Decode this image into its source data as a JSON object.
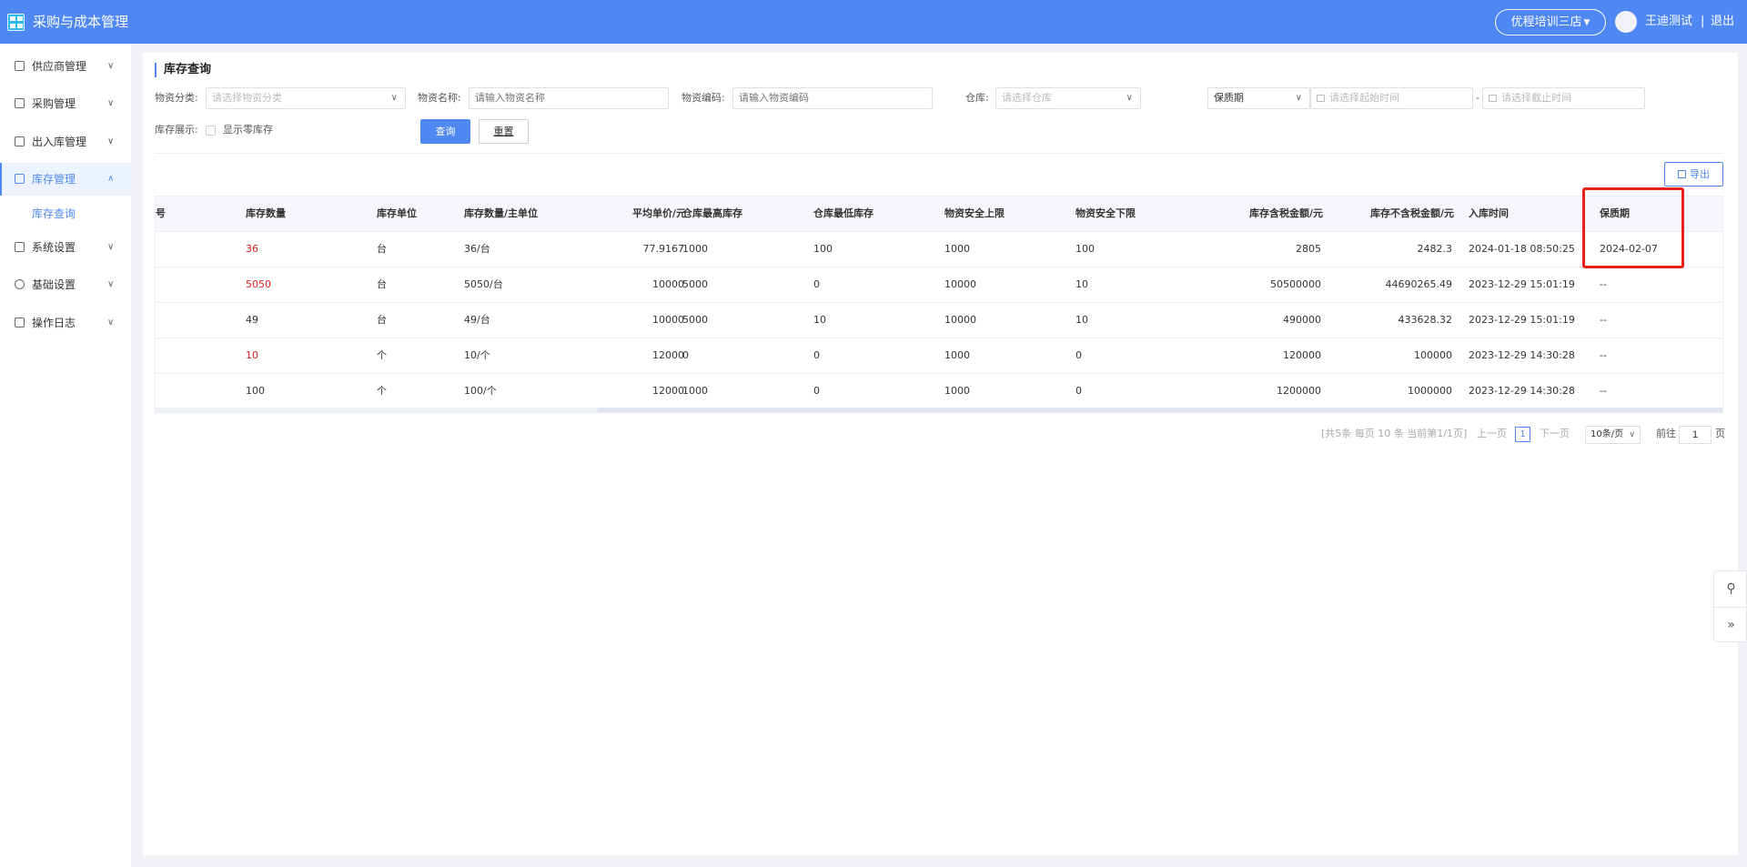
{
  "header": {
    "app_title": "采购与成本管理",
    "store": "优程培训三店",
    "user_name": "王迪测试",
    "separator": "|",
    "logout": "退出"
  },
  "sidebar": {
    "items": [
      {
        "label": "供应商管理",
        "icon": "supplier-icon"
      },
      {
        "label": "采购管理",
        "icon": "cart-icon"
      },
      {
        "label": "出入库管理",
        "icon": "inout-icon"
      },
      {
        "label": "库存管理",
        "icon": "inventory-icon"
      },
      {
        "label": "系统设置",
        "icon": "system-icon"
      },
      {
        "label": "基础设置",
        "icon": "gear-icon"
      },
      {
        "label": "操作日志",
        "icon": "log-icon"
      }
    ],
    "sub_item": "库存查询"
  },
  "page": {
    "title": "库存查询"
  },
  "filters": {
    "category_label": "物资分类:",
    "category_placeholder": "请选择物资分类",
    "name_label": "物资名称:",
    "name_placeholder": "请输入物资名称",
    "code_label": "物资编码:",
    "code_placeholder": "请输入物资编码",
    "warehouse_label": "仓库:",
    "warehouse_placeholder": "请选择仓库",
    "date_type": "保质期",
    "start_placeholder": "请选择起始时间",
    "range_sep": "-",
    "end_placeholder": "请选择截止时间",
    "display_label": "库存展示:",
    "zero_stock_label": "显示零库存",
    "zero_stock_checked": false,
    "search_button": "查询",
    "reset_button": "重置",
    "export_button": "导出"
  },
  "table": {
    "partial_header": "号",
    "columns": [
      "库存数量",
      "库存单位",
      "库存数量/主单位",
      "平均单价/元",
      "仓库最高库存",
      "仓库最低库存",
      "物资安全上限",
      "物资安全下限",
      "库存含税金额/元",
      "库存不含税金额/元",
      "入库时间",
      "保质期"
    ],
    "rows": [
      {
        "qty": "36",
        "qty_warn": true,
        "unit": "台",
        "qty_main": "36/台",
        "avg_price": "77.9167",
        "max_stock": "1000",
        "min_stock": "100",
        "safe_upper": "1000",
        "safe_lower": "100",
        "amount_tax": "2805",
        "amount_notax": "2482.3",
        "in_time": "2024-01-18 08:50:25",
        "shelf_life": "2024-02-07"
      },
      {
        "qty": "5050",
        "qty_warn": true,
        "unit": "台",
        "qty_main": "5050/台",
        "avg_price": "10000",
        "max_stock": "5000",
        "min_stock": "0",
        "safe_upper": "10000",
        "safe_lower": "10",
        "amount_tax": "50500000",
        "amount_notax": "44690265.49",
        "in_time": "2023-12-29 15:01:19",
        "shelf_life": "--"
      },
      {
        "qty": "49",
        "qty_warn": false,
        "unit": "台",
        "qty_main": "49/台",
        "avg_price": "10000",
        "max_stock": "5000",
        "min_stock": "10",
        "safe_upper": "10000",
        "safe_lower": "10",
        "amount_tax": "490000",
        "amount_notax": "433628.32",
        "in_time": "2023-12-29 15:01:19",
        "shelf_life": "--"
      },
      {
        "qty": "10",
        "qty_warn": true,
        "unit": "个",
        "qty_main": "10/个",
        "avg_price": "12000",
        "max_stock": "0",
        "min_stock": "0",
        "safe_upper": "1000",
        "safe_lower": "0",
        "amount_tax": "120000",
        "amount_notax": "100000",
        "in_time": "2023-12-29 14:30:28",
        "shelf_life": "--"
      },
      {
        "qty": "100",
        "qty_warn": false,
        "unit": "个",
        "qty_main": "100/个",
        "avg_price": "12000",
        "max_stock": "1000",
        "min_stock": "0",
        "safe_upper": "1000",
        "safe_lower": "0",
        "amount_tax": "1200000",
        "amount_notax": "1000000",
        "in_time": "2023-12-29 14:30:28",
        "shelf_life": "--"
      }
    ]
  },
  "pagination": {
    "summary": "[共5条 每页 10 条 当前第1/1页]",
    "prev": "上一页",
    "current": "1",
    "next": "下一页",
    "page_size": "10条/页",
    "goto_label": "前往",
    "goto_value": "1",
    "goto_suffix": "页"
  },
  "colors": {
    "primary": "#4f88f2",
    "warning_text": "#e02020",
    "highlight_box": "#e8201a"
  },
  "float_tools": [
    "link-icon",
    "double-chevron-right-icon"
  ]
}
